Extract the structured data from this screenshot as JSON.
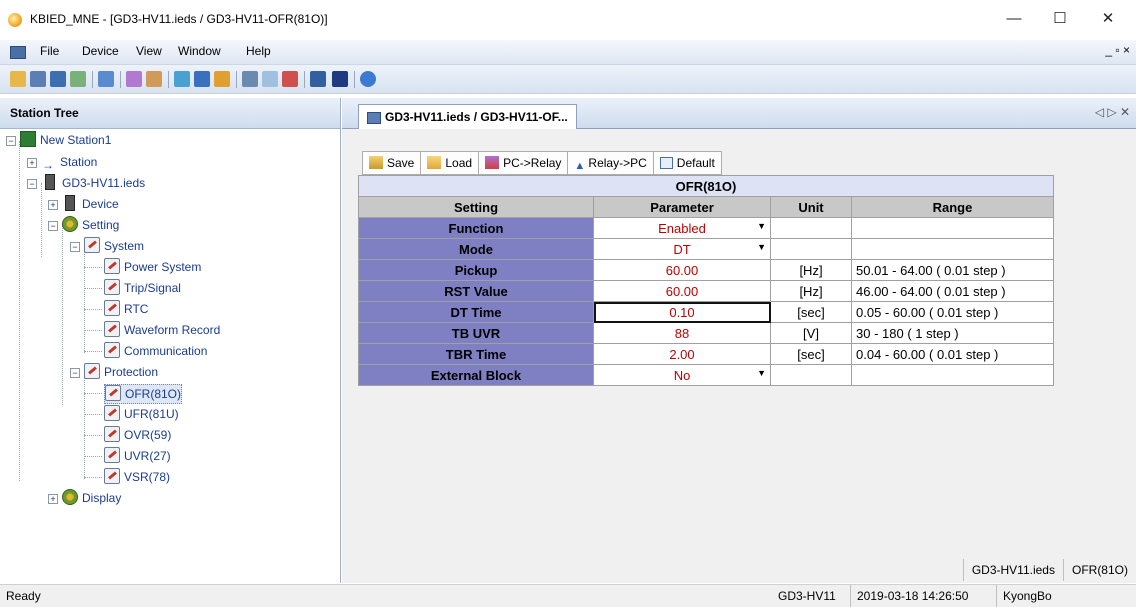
{
  "window": {
    "title": "KBIED_MNE - [GD3-HV11.ieds / GD3-HV11-OFR(81O)]",
    "minimize": "—",
    "maximize": "☐",
    "close": "✕"
  },
  "menu": {
    "items": [
      "File",
      "Device",
      "View",
      "Window",
      "Help"
    ],
    "mdi_controls": "_ ▫ ×"
  },
  "sidebar": {
    "title": "Station Tree",
    "nodes": {
      "root": "New Station1",
      "station": "Station",
      "ied": "GD3-HV11.ieds",
      "device": "Device",
      "setting": "Setting",
      "system": "System",
      "power_system": "Power System",
      "trip_signal": "Trip/Signal",
      "rtc": "RTC",
      "waveform": "Waveform Record",
      "communication": "Communication",
      "protection": "Protection",
      "ofr": "OFR(81O)",
      "ufr": "UFR(81U)",
      "ovr": "OVR(59)",
      "uvr": "UVR(27)",
      "vsr": "VSR(78)",
      "display": "Display"
    }
  },
  "tab": {
    "label": "GD3-HV11.ieds / GD3-HV11-OF...",
    "nav": "◁ ▷ ✕"
  },
  "buttons": {
    "save": "Save",
    "load": "Load",
    "pc_relay": "PC->Relay",
    "relay_pc": "Relay->PC",
    "default": "Default"
  },
  "table": {
    "caption": "OFR(81O)",
    "headers": {
      "setting": "Setting",
      "parameter": "Parameter",
      "unit": "Unit",
      "range": "Range"
    },
    "rows": [
      {
        "setting": "Function",
        "parameter": "Enabled",
        "unit": "",
        "range": ""
      },
      {
        "setting": "Mode",
        "parameter": "DT",
        "unit": "",
        "range": ""
      },
      {
        "setting": "Pickup",
        "parameter": "60.00",
        "unit": "[Hz]",
        "range": "50.01 - 64.00 ( 0.01 step )"
      },
      {
        "setting": "RST Value",
        "parameter": "60.00",
        "unit": "[Hz]",
        "range": "46.00 - 64.00 ( 0.01 step )"
      },
      {
        "setting": "DT Time",
        "parameter": "0.10",
        "unit": "[sec]",
        "range": "0.05 - 60.00 ( 0.01 step )"
      },
      {
        "setting": "TB UVR",
        "parameter": "88",
        "unit": "[V]",
        "range": "30 - 180 ( 1 step )"
      },
      {
        "setting": "TBR Time",
        "parameter": "2.00",
        "unit": "[sec]",
        "range": "0.04 - 60.00 ( 0.01 step )"
      },
      {
        "setting": "External Block",
        "parameter": "No",
        "unit": "",
        "range": ""
      }
    ]
  },
  "pane_status": {
    "file": "GD3-HV11.ieds",
    "page": "OFR(81O)"
  },
  "statusbar": {
    "left": "Ready",
    "device": "GD3-HV11",
    "datetime": "2019-03-18 14:26:50",
    "user": "KyongBo"
  },
  "colors": {
    "row_header": "#7f7fc3",
    "param_text": "#c00000",
    "caption_bg": "#dde3f4"
  }
}
